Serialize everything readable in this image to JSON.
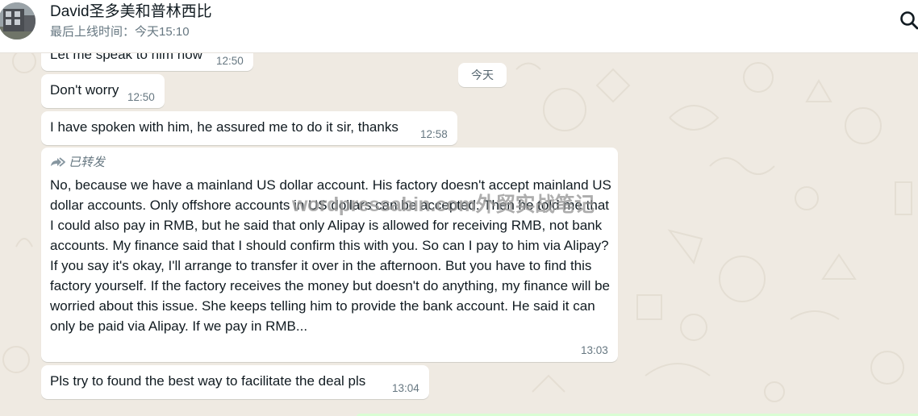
{
  "header": {
    "contact_name": "David圣多美和普林西比",
    "last_seen": "最后上线时间：今天15:10"
  },
  "messages": [
    {
      "text": "Let me speak to him now",
      "time": "12:50"
    },
    {
      "text": "Don't worry",
      "time": "12:50"
    },
    {
      "text": "I have spoken with him, he assured me to do it sir, thanks",
      "time": "12:58"
    },
    {
      "forwarded_label": "已转发",
      "text": "No, because we have a mainland US dollar account. His factory doesn't accept mainland US dollar accounts. Only offshore accounts in US dollars can be accepted. Then he told me that I could also pay in RMB, but he said that only Alipay is allowed for receiving RMB, not bank accounts. My finance said that I should confirm this with you. So can I pay to him via Alipay? If you say it's okay, I'll arrange to transfer it over in the afternoon. But you have to find this factory yourself. If the factory receives the money but doesn't do anything, my finance will be worried about this issue. She keeps telling him to provide the bank account. He said it can only be paid via Alipay. If we pay in RMB...",
      "time": "13:03"
    },
    {
      "text": "Pls try to found the best way to facilitate the deal pls",
      "time": "13:04"
    }
  ],
  "date_divider": "今天",
  "watermark": "wordpressabin.com外贸实战笔记",
  "icons": {
    "search": "search-icon",
    "forward": "forward-arrows-icon",
    "avatar": "contact-avatar"
  },
  "colors": {
    "chat_bg": "#efeae2",
    "bubble_in": "#ffffff",
    "bubble_out": "#d9fdd3",
    "meta_text": "#667781"
  }
}
